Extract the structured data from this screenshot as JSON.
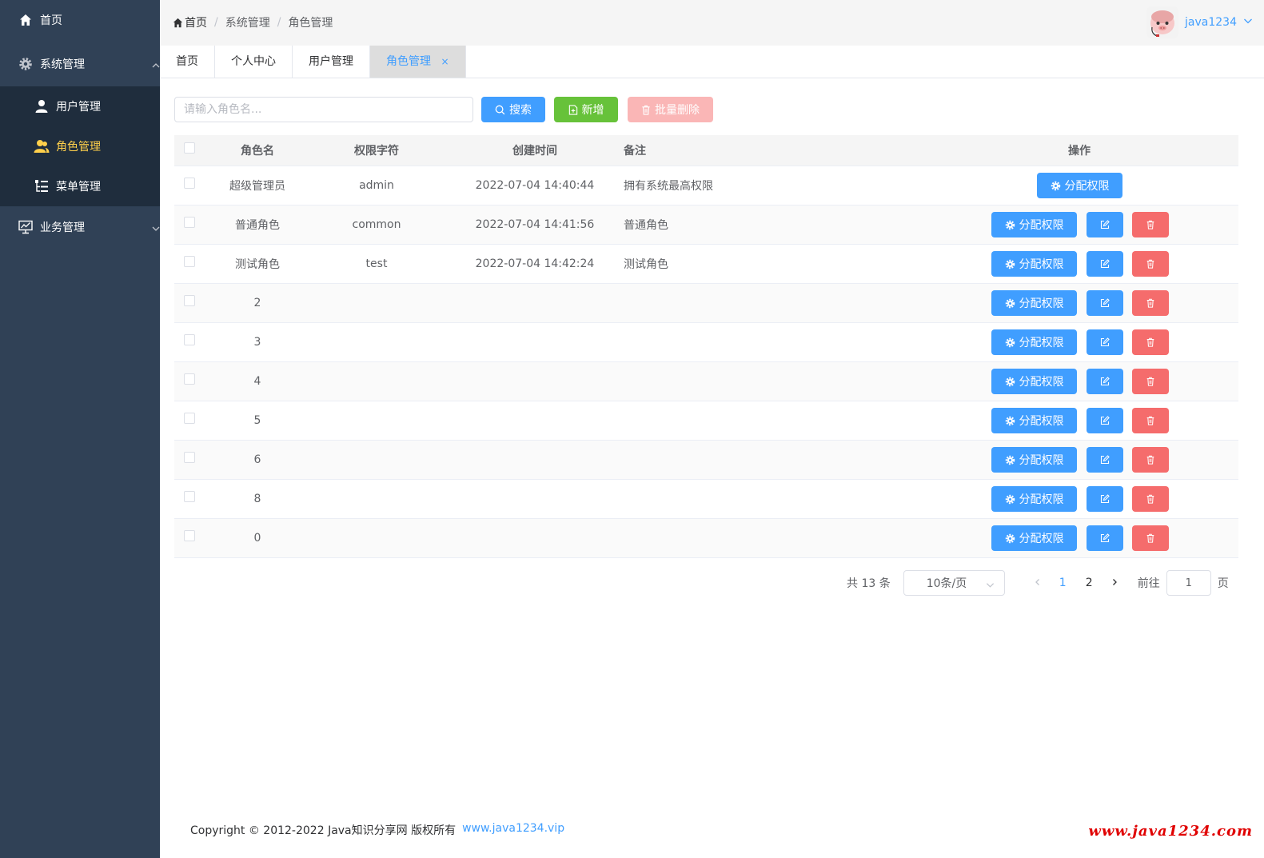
{
  "sidebar": {
    "home_label": "首页",
    "system_label": "系统管理",
    "user_mgmt_label": "用户管理",
    "role_mgmt_label": "角色管理",
    "menu_mgmt_label": "菜单管理",
    "business_label": "业务管理"
  },
  "header": {
    "breadcrumb": [
      "首页",
      "系统管理",
      "角色管理"
    ],
    "breadcrumb_sep": "/",
    "username": "java1234"
  },
  "tabs": [
    {
      "label": "首页"
    },
    {
      "label": "个人中心"
    },
    {
      "label": "用户管理"
    },
    {
      "label": "角色管理",
      "close": "×"
    }
  ],
  "toolbar": {
    "search_placeholder": "请输入角色名...",
    "search_label": "搜索",
    "add_label": "新增",
    "batch_delete_label": "批量删除"
  },
  "table": {
    "headers": {
      "name": "角色名",
      "key": "权限字符",
      "time": "创建时间",
      "remark": "备注",
      "op": "操作"
    },
    "assign_label": "分配权限",
    "rows": [
      {
        "name": "超级管理员",
        "key": "admin",
        "time": "2022-07-04 14:40:44",
        "remark": "拥有系统最高权限"
      },
      {
        "name": "普通角色",
        "key": "common",
        "time": "2022-07-04 14:41:56",
        "remark": "普通角色"
      },
      {
        "name": "测试角色",
        "key": "test",
        "time": "2022-07-04 14:42:24",
        "remark": "测试角色"
      },
      {
        "name": "2",
        "key": "",
        "time": "",
        "remark": ""
      },
      {
        "name": "3",
        "key": "",
        "time": "",
        "remark": ""
      },
      {
        "name": "4",
        "key": "",
        "time": "",
        "remark": ""
      },
      {
        "name": "5",
        "key": "",
        "time": "",
        "remark": ""
      },
      {
        "name": "6",
        "key": "",
        "time": "",
        "remark": ""
      },
      {
        "name": "8",
        "key": "",
        "time": "",
        "remark": ""
      },
      {
        "name": "0",
        "key": "",
        "time": "",
        "remark": ""
      }
    ]
  },
  "pagination": {
    "total": "共 13 条",
    "page_size": "10条/页",
    "pages": [
      "1",
      "2"
    ],
    "current": "1",
    "goto_label": "前往",
    "goto_value": "1",
    "page_unit": "页"
  },
  "footer": {
    "copyright": "Copyright © 2012-2022 Java知识分享网 版权所有",
    "link": "www.java1234.vip",
    "watermark": "www.java1234.com"
  },
  "colors": {
    "sidebar_bg": "#304156",
    "primary": "#409eff",
    "success": "#67c23a",
    "danger": "#f56c6c",
    "active_menu": "#ffd04b"
  }
}
